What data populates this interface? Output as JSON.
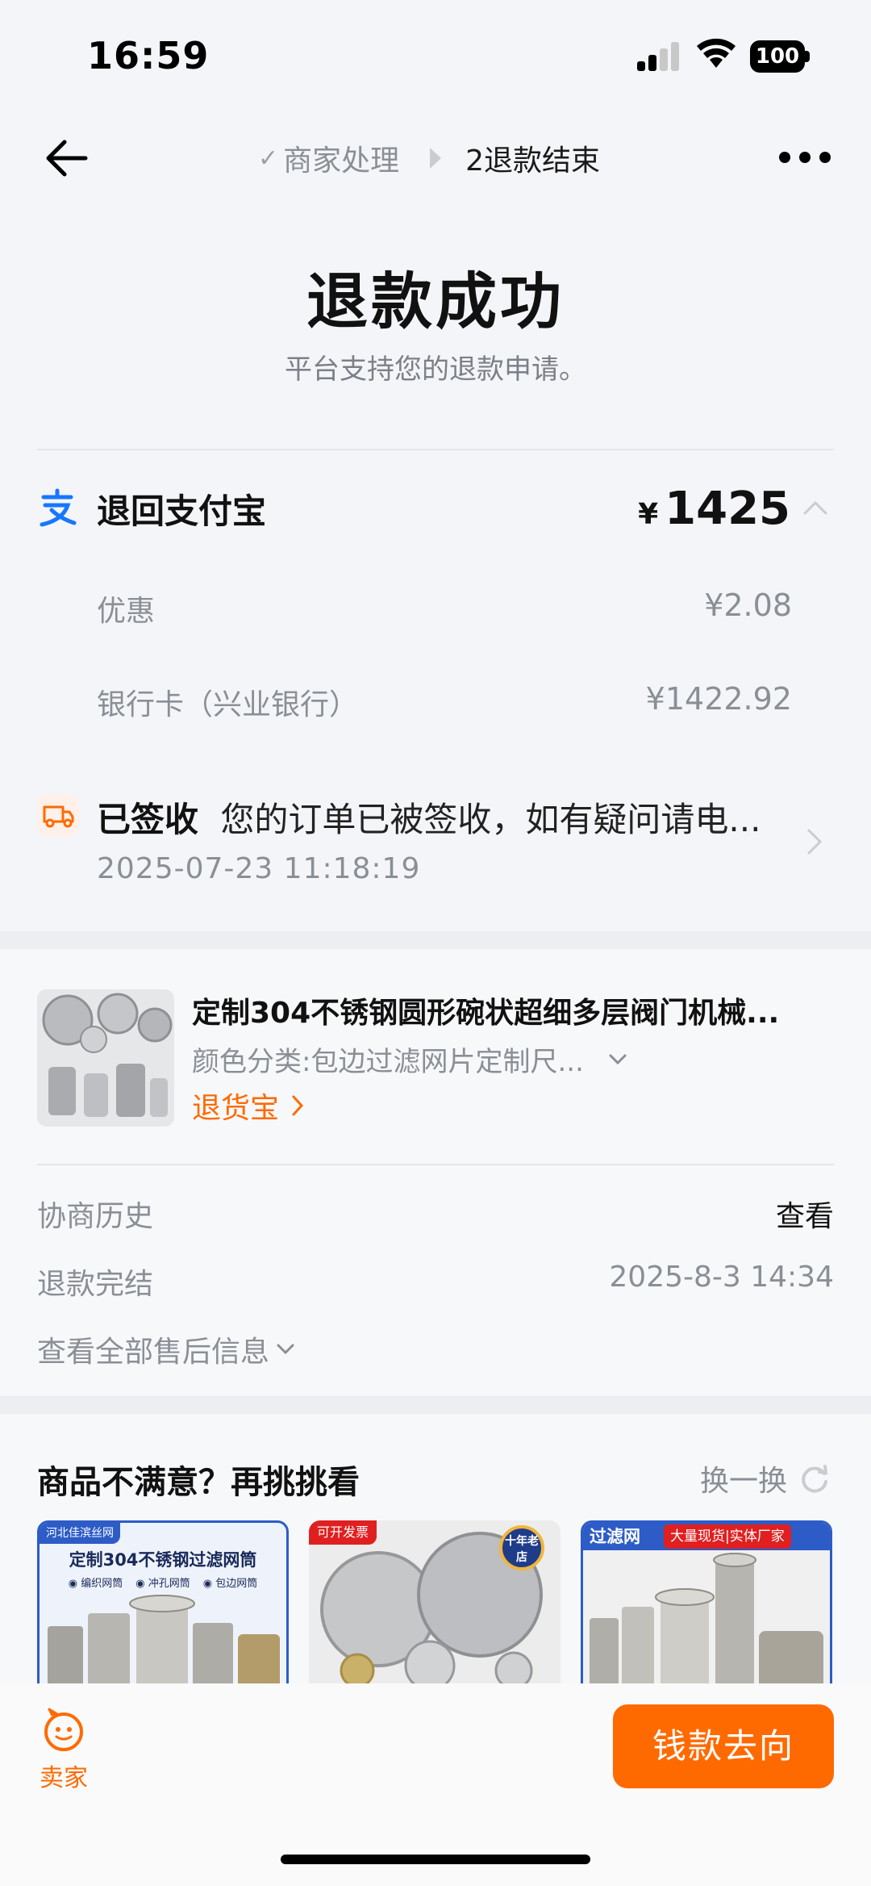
{
  "status_bar": {
    "time": "16:59",
    "battery": "100"
  },
  "nav": {
    "step_prev": "商家处理",
    "step_current": "2退款结束"
  },
  "header": {
    "title": "退款成功",
    "subtitle": "平台支持您的退款申请。"
  },
  "refund": {
    "label": "退回支付宝",
    "currency": "¥",
    "amount": "1425",
    "breakdown": [
      {
        "label": "优惠",
        "value": "¥2.08"
      },
      {
        "label": "银行卡（兴业银行）",
        "value": "¥1422.92"
      }
    ]
  },
  "logistics": {
    "status": "已签收",
    "description": "您的订单已被签收，如有疑问请电...",
    "time": "2025-07-23 11:18:19"
  },
  "product": {
    "title": "定制304不锈钢圆形碗状超细多层阀门机械...",
    "spec": "颜色分类:包边过滤网片定制尺...",
    "return_link": "退货宝"
  },
  "info": {
    "history_label": "协商历史",
    "history_action": "查看",
    "finish_label": "退款完结",
    "finish_time": "2025-8-3 14:34",
    "view_all": "查看全部售后信息"
  },
  "recommend": {
    "title": "商品不满意？再挑挑看",
    "refresh": "换一换",
    "items": [
      {
        "banner": "河北佳滨丝网",
        "headline": "定制304不锈钢过滤网筒",
        "tags": [
          "编织网筒",
          "冲孔网筒",
          "包边网筒"
        ]
      },
      {
        "badge": "可开发票",
        "seal": "十年老店"
      },
      {
        "badge": "过滤网",
        "banner": "大量现货|实体厂家"
      }
    ]
  },
  "bottom": {
    "seller": "卖家",
    "primary": "钱款去向"
  },
  "colors": {
    "accent": "#ff6a00",
    "alipay": "#1677ff",
    "text_secondary": "#8a8f96"
  }
}
